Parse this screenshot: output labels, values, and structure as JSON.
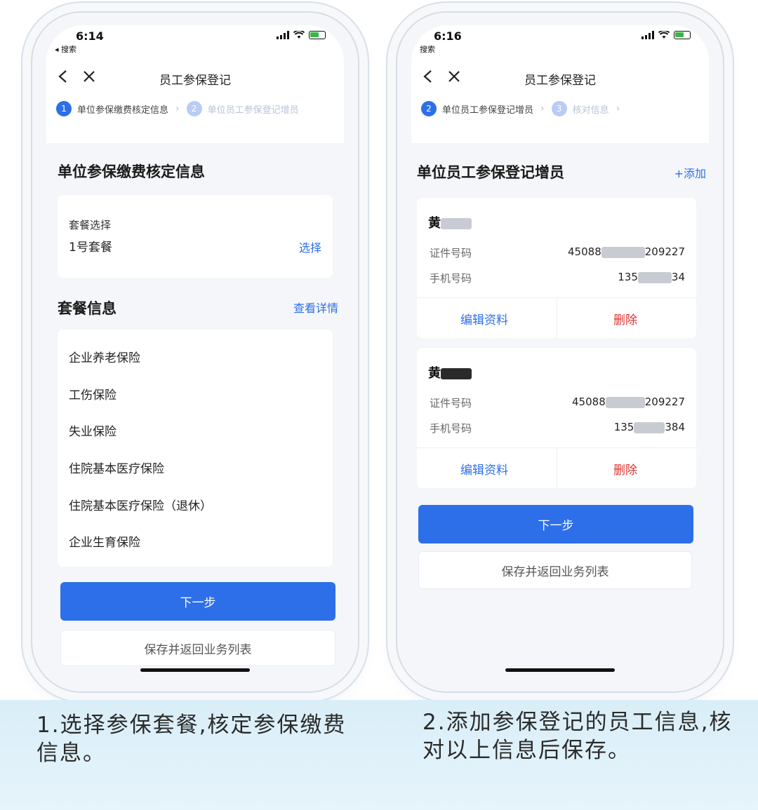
{
  "colors": {
    "accent": "#2d6fe8",
    "danger": "#e03030",
    "caption_band": "#d9eef8"
  },
  "captions": {
    "step1": "1.选择参保套餐,核定参保缴费信息。",
    "step2": "2.添加参保登记的员工信息,核对以上信息后保存。"
  },
  "phone1": {
    "status": {
      "time": "6:14",
      "back_app": "◂ 搜索"
    },
    "nav": {
      "title": "员工参保登记"
    },
    "steps": [
      {
        "num": "1",
        "label": "单位参保缴费核定信息",
        "active": true
      },
      {
        "num": "2",
        "label": "单位员工参保登记增员",
        "active": false
      }
    ],
    "section_title": "单位参保缴费核定信息",
    "package": {
      "label": "套餐选择",
      "value": "1号套餐",
      "action": "选择"
    },
    "info": {
      "title": "套餐信息",
      "detail_link": "查看详情",
      "items": [
        "企业养老保险",
        "工伤保险",
        "失业保险",
        "住院基本医疗保险",
        "住院基本医疗保险（退休）",
        "企业生育保险"
      ]
    },
    "buttons": {
      "next": "下一步",
      "save": "保存并返回业务列表"
    }
  },
  "phone2": {
    "status": {
      "time": "6:16",
      "back_app": "搜索"
    },
    "nav": {
      "title": "员工参保登记"
    },
    "steps": [
      {
        "num": "2",
        "label": "单位员工参保登记增员",
        "active": true
      },
      {
        "num": "3",
        "label": "核对信息",
        "active": false
      }
    ],
    "section_title": "单位员工参保登记增员",
    "add_link": "+添加",
    "employees": [
      {
        "name": "黄",
        "id_label": "证件号码",
        "id_prefix": "45088",
        "id_suffix": "209227",
        "phone_label": "手机号码",
        "phone_prefix": "135",
        "phone_suffix": "34",
        "edit": "编辑资料",
        "delete": "删除"
      },
      {
        "name": "黄",
        "id_label": "证件号码",
        "id_prefix": "45088",
        "id_suffix": "209227",
        "phone_label": "手机号码",
        "phone_prefix": "135",
        "phone_suffix": "384",
        "edit": "编辑资料",
        "delete": "删除"
      }
    ],
    "buttons": {
      "next": "下一步",
      "save": "保存并返回业务列表"
    }
  }
}
